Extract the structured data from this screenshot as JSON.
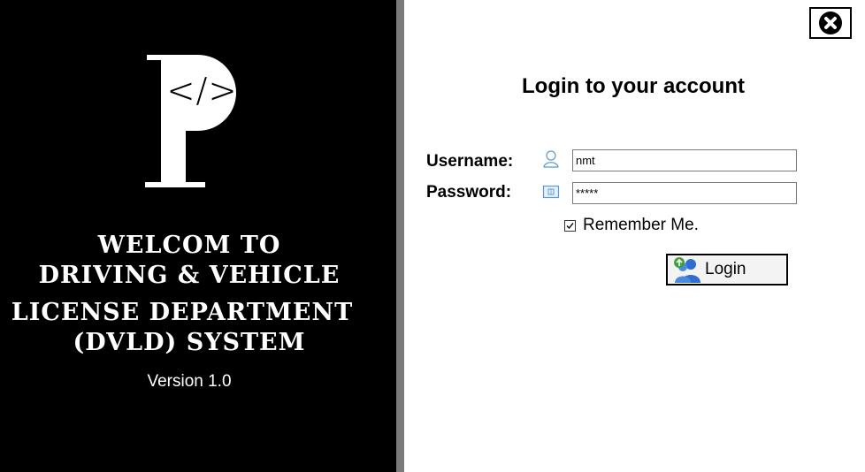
{
  "branding": {
    "logo_letter": "P",
    "logo_code_glyph": "</>",
    "welcome_lines": [
      "WELCOM TO",
      "DRIVING & VEHICLE",
      "LICENSE DEPARTMENT",
      "(DVLD) SYSTEM"
    ],
    "version": "Version 1.0"
  },
  "login": {
    "title": "Login to your account",
    "username_label": "Username:",
    "username_value": "nmt",
    "password_label": "Password:",
    "password_value": "*****",
    "remember_label": "Remember Me.",
    "remember_checked": true,
    "login_button_label": "Login"
  },
  "icons": {
    "close": "close-icon",
    "username": "user-icon",
    "password": "password-icon",
    "login": "login-users-icon"
  },
  "colors": {
    "left_panel_bg": "#000000",
    "divider": "#7a7a7a",
    "field_icon": "#5b9bd5",
    "login_icon_blue": "#2f6fd0",
    "login_icon_green": "#3ea03e"
  }
}
